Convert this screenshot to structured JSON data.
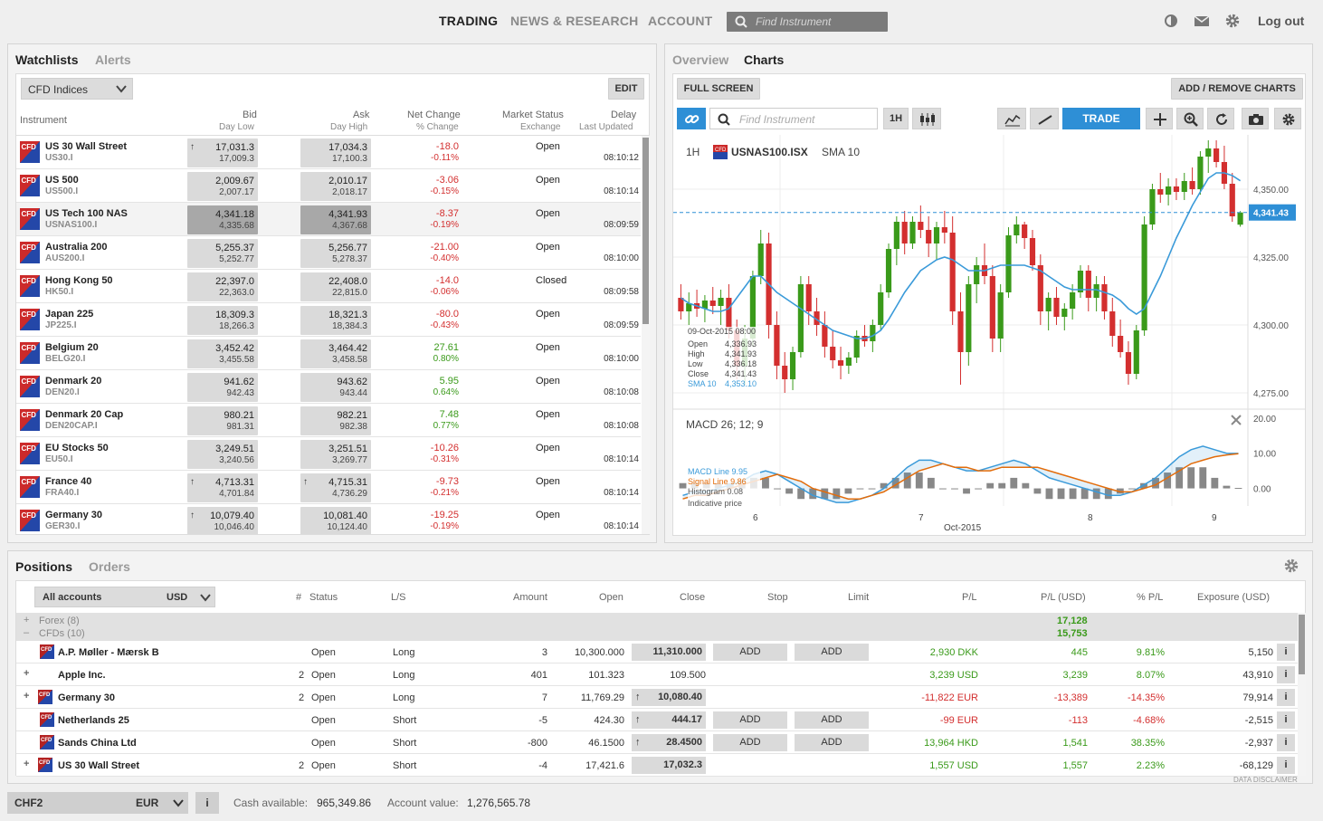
{
  "nav": {
    "trading": "TRADING",
    "news": "NEWS & RESEARCH",
    "account": "ACCOUNT",
    "search_placeholder": "Find Instrument",
    "logout": "Log out"
  },
  "watchlist": {
    "tab_watchlists": "Watchlists",
    "tab_alerts": "Alerts",
    "selector": "CFD Indices",
    "edit": "EDIT",
    "headers": {
      "instrument": "Instrument",
      "bid": "Bid",
      "day_low": "Day Low",
      "ask": "Ask",
      "day_high": "Day High",
      "net_change": "Net Change",
      "pct_change": "% Change",
      "market_status": "Market Status",
      "exchange": "Exchange",
      "delay": "Delay",
      "last_updated": "Last Updated"
    },
    "rows": [
      {
        "name": "US 30 Wall Street",
        "ticker": "US30.I",
        "bid": "17,031.3",
        "low": "17,009.3",
        "ask": "17,034.3",
        "high": "17,100.3",
        "chg": "-18.0",
        "pct": "-0.11%",
        "status": "Open",
        "time": "08:10:12",
        "up": true,
        "upAsk": false,
        "dir": "neg",
        "sel": false
      },
      {
        "name": "US 500",
        "ticker": "US500.I",
        "bid": "2,009.67",
        "low": "2,007.17",
        "ask": "2,010.17",
        "high": "2,018.17",
        "chg": "-3.06",
        "pct": "-0.15%",
        "status": "Open",
        "time": "08:10:14",
        "up": false,
        "upAsk": false,
        "dir": "neg",
        "sel": false
      },
      {
        "name": "US Tech 100 NAS",
        "ticker": "USNAS100.I",
        "bid": "4,341.18",
        "low": "4,335.68",
        "ask": "4,341.93",
        "high": "4,367.68",
        "chg": "-8.37",
        "pct": "-0.19%",
        "status": "Open",
        "time": "08:09:59",
        "up": false,
        "upAsk": false,
        "dir": "neg",
        "sel": true
      },
      {
        "name": "Australia 200",
        "ticker": "AUS200.I",
        "bid": "5,255.37",
        "low": "5,252.77",
        "ask": "5,256.77",
        "high": "5,278.37",
        "chg": "-21.00",
        "pct": "-0.40%",
        "status": "Open",
        "time": "08:10:00",
        "up": false,
        "upAsk": false,
        "dir": "neg",
        "sel": false
      },
      {
        "name": "Hong Kong 50",
        "ticker": "HK50.I",
        "bid": "22,397.0",
        "low": "22,363.0",
        "ask": "22,408.0",
        "high": "22,815.0",
        "chg": "-14.0",
        "pct": "-0.06%",
        "status": "Closed",
        "time": "08:09:58",
        "up": false,
        "upAsk": false,
        "dir": "neg",
        "sel": false
      },
      {
        "name": "Japan 225",
        "ticker": "JP225.I",
        "bid": "18,309.3",
        "low": "18,266.3",
        "ask": "18,321.3",
        "high": "18,384.3",
        "chg": "-80.0",
        "pct": "-0.43%",
        "status": "Open",
        "time": "08:09:59",
        "up": false,
        "upAsk": false,
        "dir": "neg",
        "sel": false
      },
      {
        "name": "Belgium 20",
        "ticker": "BELG20.I",
        "bid": "3,452.42",
        "low": "3,455.58",
        "ask": "3,464.42",
        "high": "3,458.58",
        "chg": "27.61",
        "pct": "0.80%",
        "status": "Open",
        "time": "08:10:00",
        "up": false,
        "upAsk": false,
        "dir": "pos",
        "sel": false
      },
      {
        "name": "Denmark 20",
        "ticker": "DEN20.I",
        "bid": "941.62",
        "low": "942.43",
        "ask": "943.62",
        "high": "943.44",
        "chg": "5.95",
        "pct": "0.64%",
        "status": "Open",
        "time": "08:10:08",
        "up": false,
        "upAsk": false,
        "dir": "pos",
        "sel": false
      },
      {
        "name": "Denmark 20 Cap",
        "ticker": "DEN20CAP.I",
        "bid": "980.21",
        "low": "981.31",
        "ask": "982.21",
        "high": "982.38",
        "chg": "7.48",
        "pct": "0.77%",
        "status": "Open",
        "time": "08:10:08",
        "up": false,
        "upAsk": false,
        "dir": "pos",
        "sel": false
      },
      {
        "name": "EU Stocks 50",
        "ticker": "EU50.I",
        "bid": "3,249.51",
        "low": "3,240.56",
        "ask": "3,251.51",
        "high": "3,269.77",
        "chg": "-10.26",
        "pct": "-0.31%",
        "status": "Open",
        "time": "08:10:14",
        "up": false,
        "upAsk": false,
        "dir": "neg",
        "sel": false
      },
      {
        "name": "France 40",
        "ticker": "FRA40.I",
        "bid": "4,713.31",
        "low": "4,701.84",
        "ask": "4,715.31",
        "high": "4,736.29",
        "chg": "-9.73",
        "pct": "-0.21%",
        "status": "Open",
        "time": "08:10:14",
        "up": true,
        "upAsk": true,
        "dir": "neg",
        "sel": false
      },
      {
        "name": "Germany 30",
        "ticker": "GER30.I",
        "bid": "10,079.40",
        "low": "10,046.40",
        "ask": "10,081.40",
        "high": "10,124.40",
        "chg": "-19.25",
        "pct": "-0.19%",
        "status": "Open",
        "time": "08:10:14",
        "up": true,
        "upAsk": false,
        "dir": "neg",
        "sel": false
      }
    ]
  },
  "charts": {
    "tab_overview": "Overview",
    "tab_charts": "Charts",
    "full_screen": "FULL SCREEN",
    "add_remove": "ADD / REMOVE CHARTS",
    "search_placeholder": "Find Instrument",
    "interval": "1H",
    "trade": "TRADE",
    "legend_interval": "1H",
    "legend_symbol": "USNAS100.ISX",
    "legend_sma": "SMA 10",
    "price_ticks": [
      "4,350.00",
      "4,325.00",
      "4,300.00",
      "4,275.00"
    ],
    "current_price": "4,341.43",
    "tooltip": {
      "date": "09-Oct-2015 08:00",
      "open_l": "Open",
      "open": "4,336.93",
      "high_l": "High",
      "high": "4,341.93",
      "low_l": "Low",
      "low": "4,336.18",
      "close_l": "Close",
      "close": "4,341.43",
      "sma_l": "SMA 10",
      "sma": "4,353.10"
    },
    "macd_title": "MACD 26; 12; 9",
    "macd_ticks": [
      "20.00",
      "10.00",
      "0.00"
    ],
    "macd_line_l": "MACD Line",
    "macd_line": "9.95",
    "signal_l": "Signal Line",
    "signal": "9.86",
    "hist_l": "Histogram",
    "hist": "0.08",
    "indicative": "Indicative price",
    "x_ticks": [
      "6",
      "7",
      "8",
      "9"
    ],
    "x_month": "Oct-2015"
  },
  "chart_data": {
    "type": "candlestick",
    "title": "USNAS100.ISX",
    "interval": "1H",
    "ylim": [
      4270,
      4370
    ],
    "x_labels": [
      "6",
      "7",
      "8",
      "9"
    ],
    "candles": [
      [
        4310,
        4315,
        4302,
        4305
      ],
      [
        4305,
        4312,
        4300,
        4308
      ],
      [
        4308,
        4313,
        4303,
        4306
      ],
      [
        4306,
        4311,
        4301,
        4309
      ],
      [
        4309,
        4314,
        4304,
        4307
      ],
      [
        4307,
        4313,
        4300,
        4310
      ],
      [
        4310,
        4315,
        4295,
        4298
      ],
      [
        4298,
        4302,
        4280,
        4285
      ],
      [
        4285,
        4300,
        4278,
        4295
      ],
      [
        4295,
        4320,
        4292,
        4318
      ],
      [
        4318,
        4335,
        4315,
        4330
      ],
      [
        4330,
        4334,
        4295,
        4300
      ],
      [
        4300,
        4305,
        4280,
        4285
      ],
      [
        4285,
        4290,
        4275,
        4280
      ],
      [
        4280,
        4292,
        4276,
        4290
      ],
      [
        4290,
        4318,
        4288,
        4315
      ],
      [
        4315,
        4318,
        4300,
        4305
      ],
      [
        4305,
        4310,
        4296,
        4300
      ],
      [
        4300,
        4305,
        4288,
        4292
      ],
      [
        4292,
        4298,
        4284,
        4287
      ],
      [
        4287,
        4292,
        4280,
        4285
      ],
      [
        4285,
        4290,
        4282,
        4288
      ],
      [
        4288,
        4298,
        4286,
        4296
      ],
      [
        4296,
        4300,
        4292,
        4294
      ],
      [
        4294,
        4302,
        4290,
        4300
      ],
      [
        4300,
        4315,
        4298,
        4312
      ],
      [
        4312,
        4330,
        4310,
        4328
      ],
      [
        4328,
        4340,
        4322,
        4338
      ],
      [
        4338,
        4342,
        4326,
        4330
      ],
      [
        4330,
        4340,
        4328,
        4338
      ],
      [
        4338,
        4344,
        4332,
        4335
      ],
      [
        4335,
        4340,
        4325,
        4330
      ],
      [
        4330,
        4338,
        4324,
        4336
      ],
      [
        4336,
        4342,
        4330,
        4334
      ],
      [
        4334,
        4340,
        4300,
        4305
      ],
      [
        4305,
        4312,
        4278,
        4290
      ],
      [
        4290,
        4318,
        4285,
        4315
      ],
      [
        4315,
        4325,
        4308,
        4322
      ],
      [
        4322,
        4330,
        4315,
        4318
      ],
      [
        4318,
        4322,
        4290,
        4295
      ],
      [
        4295,
        4315,
        4290,
        4312
      ],
      [
        4312,
        4336,
        4310,
        4333
      ],
      [
        4333,
        4340,
        4330,
        4337
      ],
      [
        4337,
        4338,
        4328,
        4332
      ],
      [
        4332,
        4335,
        4320,
        4322
      ],
      [
        4322,
        4326,
        4300,
        4305
      ],
      [
        4305,
        4312,
        4298,
        4310
      ],
      [
        4310,
        4314,
        4300,
        4303
      ],
      [
        4303,
        4308,
        4298,
        4306
      ],
      [
        4306,
        4315,
        4302,
        4312
      ],
      [
        4312,
        4322,
        4310,
        4320
      ],
      [
        4320,
        4322,
        4305,
        4310
      ],
      [
        4310,
        4318,
        4305,
        4315
      ],
      [
        4315,
        4318,
        4302,
        4305
      ],
      [
        4305,
        4310,
        4292,
        4296
      ],
      [
        4296,
        4302,
        4288,
        4290
      ],
      [
        4290,
        4294,
        4278,
        4282
      ],
      [
        4282,
        4300,
        4280,
        4298
      ],
      [
        4298,
        4340,
        4296,
        4337
      ],
      [
        4337,
        4352,
        4335,
        4350
      ],
      [
        4350,
        4356,
        4345,
        4348
      ],
      [
        4348,
        4354,
        4344,
        4351
      ],
      [
        4351,
        4354,
        4346,
        4349
      ],
      [
        4349,
        4356,
        4346,
        4353
      ],
      [
        4353,
        4358,
        4348,
        4350
      ],
      [
        4350,
        4364,
        4348,
        4362
      ],
      [
        4362,
        4368,
        4356,
        4365
      ],
      [
        4365,
        4368,
        4358,
        4360
      ],
      [
        4360,
        4366,
        4350,
        4352
      ],
      [
        4352,
        4356,
        4338,
        4340
      ],
      [
        4336.93,
        4341.93,
        4336.18,
        4341.43
      ]
    ],
    "sma10": [
      4310,
      4308,
      4307,
      4306,
      4305,
      4305,
      4306,
      4310,
      4314,
      4318,
      4318,
      4315,
      4312,
      4310,
      4308,
      4306,
      4304,
      4302,
      4300,
      4298,
      4297,
      4296,
      4295,
      4295,
      4296,
      4298,
      4302,
      4307,
      4312,
      4316,
      4320,
      4322,
      4324,
      4325,
      4324,
      4322,
      4320,
      4320,
      4320,
      4321,
      4322,
      4322,
      4322,
      4322,
      4321,
      4320,
      4318,
      4316,
      4314,
      4313,
      4313,
      4313,
      4313,
      4312,
      4311,
      4309,
      4306,
      4304,
      4306,
      4312,
      4318,
      4325,
      4332,
      4338,
      4344,
      4349,
      4354,
      4356,
      4356,
      4355,
      4353.1
    ],
    "macd": [
      -2,
      -1,
      -1,
      0,
      1,
      2,
      4,
      5,
      4,
      2,
      0,
      -2,
      -3,
      -4,
      -4,
      -3,
      -2,
      0,
      3,
      6,
      8,
      8,
      7,
      6,
      5,
      5,
      6,
      7,
      8,
      7,
      5,
      3,
      2,
      1,
      0,
      -1,
      -2,
      -2,
      -1,
      1,
      3,
      6,
      9,
      11,
      12,
      11,
      10,
      9.95
    ],
    "signal": [
      -3,
      -2,
      -2,
      -1,
      0,
      1,
      2,
      3,
      4,
      3,
      2,
      0,
      -1,
      -2,
      -3,
      -3,
      -2,
      -1,
      1,
      3,
      5,
      6,
      7,
      6,
      6,
      5,
      5,
      6,
      6,
      6,
      6,
      5,
      4,
      3,
      2,
      1,
      0,
      -1,
      -1,
      0,
      1,
      3,
      5,
      7,
      8,
      9,
      9.5,
      9.86
    ],
    "macd_ylim": [
      -5,
      22
    ]
  },
  "positions": {
    "tab_positions": "Positions",
    "tab_orders": "Orders",
    "account_selector": "All accounts",
    "currency": "USD",
    "headers": {
      "num": "#",
      "status": "Status",
      "ls": "L/S",
      "amount": "Amount",
      "open": "Open",
      "close": "Close",
      "stop": "Stop",
      "limit": "Limit",
      "pl": "P/L",
      "pl_usd": "P/L (USD)",
      "pct_pl": "% P/L",
      "exposure": "Exposure (USD)"
    },
    "groups": [
      {
        "label": "Forex (8)",
        "total": "17,128"
      },
      {
        "label": "CFDs (10)",
        "total": "15,753"
      }
    ],
    "rows": [
      {
        "expand": "",
        "name": "A.P. Møller - Mærsk B",
        "num": "",
        "status": "Open",
        "ls": "Long",
        "amount": "3",
        "open": "10,300.000",
        "close": "11,310.000",
        "closeBox": true,
        "closeArrow": false,
        "stop": "ADD",
        "limit": "ADD",
        "pl": "2,930 DKK",
        "plusd": "445",
        "pct": "9.81%",
        "exp": "5,150",
        "dir": "pos",
        "flag": "dk"
      },
      {
        "expand": "+",
        "name": "Apple Inc.",
        "num": "2",
        "status": "Open",
        "ls": "Long",
        "amount": "401",
        "open": "101.323",
        "close": "109.500",
        "closeBox": false,
        "closeArrow": false,
        "stop": "",
        "limit": "",
        "pl": "3,239 USD",
        "plusd": "3,239",
        "pct": "8.07%",
        "exp": "43,910",
        "dir": "pos",
        "flag": "none"
      },
      {
        "expand": "+",
        "name": "Germany 30",
        "num": "2",
        "status": "Open",
        "ls": "Long",
        "amount": "7",
        "open": "11,769.29",
        "close": "10,080.40",
        "closeBox": true,
        "closeArrow": true,
        "stop": "",
        "limit": "",
        "pl": "-11,822 EUR",
        "plusd": "-13,389",
        "pct": "-14.35%",
        "exp": "79,914",
        "dir": "neg",
        "flag": "eu"
      },
      {
        "expand": "",
        "name": "Netherlands 25",
        "num": "",
        "status": "Open",
        "ls": "Short",
        "amount": "-5",
        "open": "424.30",
        "close": "444.17",
        "closeBox": true,
        "closeArrow": true,
        "stop": "ADD",
        "limit": "ADD",
        "pl": "-99 EUR",
        "plusd": "-113",
        "pct": "-4.68%",
        "exp": "-2,515",
        "dir": "neg",
        "flag": "eu"
      },
      {
        "expand": "",
        "name": "Sands China Ltd",
        "num": "",
        "status": "Open",
        "ls": "Short",
        "amount": "-800",
        "open": "46.1500",
        "close": "28.4500",
        "closeBox": true,
        "closeArrow": true,
        "stop": "ADD",
        "limit": "ADD",
        "pl": "13,964 HKD",
        "plusd": "1,541",
        "pct": "38.35%",
        "exp": "-2,937",
        "dir": "pos",
        "flag": "hk"
      },
      {
        "expand": "+",
        "name": "US 30 Wall Street",
        "num": "2",
        "status": "Open",
        "ls": "Short",
        "amount": "-4",
        "open": "17,421.6",
        "close": "17,032.3",
        "closeBox": true,
        "closeArrow": false,
        "stop": "",
        "limit": "",
        "pl": "1,557 USD",
        "plusd": "1,557",
        "pct": "2.23%",
        "exp": "-68,129",
        "dir": "pos",
        "flag": "us"
      }
    ],
    "disclaimer": "DATA DISCLAIMER"
  },
  "bottom": {
    "account": "CHF2",
    "currency": "EUR",
    "info": "i",
    "cash_label": "Cash available:",
    "cash": "965,349.86",
    "value_label": "Account value:",
    "value": "1,276,565.78"
  },
  "colors": {
    "up": "#3a9a1a",
    "down": "#d32f2f",
    "accent": "#2e8fd6",
    "sma": "#3a9ad9",
    "signal": "#e36c0a"
  }
}
